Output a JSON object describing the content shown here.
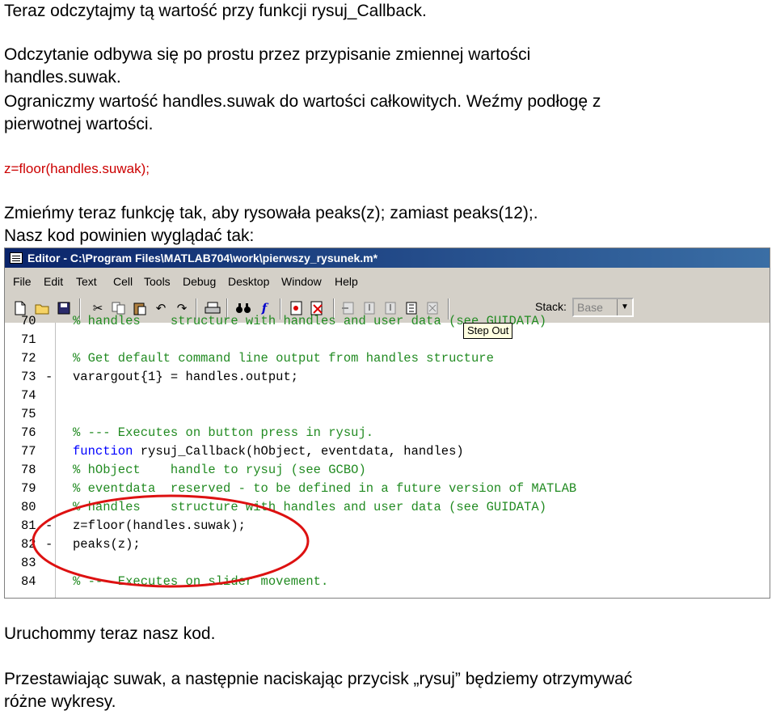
{
  "paragraphs": {
    "p1": "Teraz odczytajmy tą wartość przy funkcji rysuj_Callback.",
    "p2a": "Odczytanie odbywa się po prostu przez przypisanie zmiennej wartości",
    "p2b": "handles.suwak.",
    "p3a": "Ograniczmy wartość handles.suwak do wartości całkowitych. Weźmy podłogę z",
    "p3b": "pierwotnej wartości.",
    "code": "z=floor(handles.suwak);",
    "p4a": "Zmieńmy teraz funkcję tak, aby rysowała peaks(z); zamiast peaks(12);.",
    "p4b": "Nasz kod powinien wyglądać tak:",
    "p5": "Uruchommy teraz nasz kod.",
    "p6a": "Przestawiając suwak, a następnie naciskając przycisk „rysuj” będziemy otrzymywać",
    "p6b": "różne wykresy."
  },
  "editor": {
    "title": "Editor - C:\\Program Files\\MATLAB704\\work\\pierwszy_rysunek.m*",
    "menu": [
      "File",
      "Edit",
      "Text",
      "Cell",
      "Tools",
      "Debug",
      "Desktop",
      "Window",
      "Help"
    ],
    "toolbar": {
      "stack_label": "Stack:",
      "stack_value": "Base",
      "tooltip": "Step Out",
      "icons": [
        "new-file-icon",
        "open-icon",
        "save-icon",
        "cut-icon",
        "copy-icon",
        "paste-icon",
        "undo-icon",
        "redo-icon",
        "print-icon",
        "find-icon",
        "function-icon",
        "set-breakpoint-icon",
        "clear-breakpoints-icon",
        "step-icon",
        "step-in-icon",
        "step-out-icon",
        "continue-icon",
        "exit-debug-icon"
      ]
    },
    "lines": [
      {
        "num": "70",
        "dash": "",
        "code": "% handles    structure with handles and user data (see GUIDATA)",
        "style": "cmt"
      },
      {
        "num": "71",
        "dash": "",
        "code": "",
        "style": ""
      },
      {
        "num": "72",
        "dash": "",
        "code": "% Get default command line output from handles structure",
        "style": "cmt"
      },
      {
        "num": "73",
        "dash": "-",
        "code": "varargout{1} = handles.output;",
        "style": ""
      },
      {
        "num": "74",
        "dash": "",
        "code": "",
        "style": ""
      },
      {
        "num": "75",
        "dash": "",
        "code": "",
        "style": ""
      },
      {
        "num": "76",
        "dash": "",
        "code": "% --- Executes on button press in rysuj.",
        "style": "cmt"
      },
      {
        "num": "77",
        "dash": "",
        "code_kw": "function",
        "code": " rysuj_Callback(hObject, eventdata, handles)",
        "style": "kw"
      },
      {
        "num": "78",
        "dash": "",
        "code": "% hObject    handle to rysuj (see GCBO)",
        "style": "cmt"
      },
      {
        "num": "79",
        "dash": "",
        "code": "% eventdata  reserved - to be defined in a future version of MATLAB",
        "style": "cmt"
      },
      {
        "num": "80",
        "dash": "",
        "code": "% handles    structure with handles and user data (see GUIDATA)",
        "style": "cmt"
      },
      {
        "num": "81",
        "dash": "-",
        "code": "z=floor(handles.suwak);",
        "style": ""
      },
      {
        "num": "82",
        "dash": "-",
        "code": "peaks(z);",
        "style": ""
      },
      {
        "num": "83",
        "dash": "",
        "code": "",
        "style": ""
      },
      {
        "num": "84",
        "dash": "",
        "code": "% --- Executes on slider movement.",
        "style": "cmt"
      }
    ],
    "annotation_color": "#dd1111"
  }
}
